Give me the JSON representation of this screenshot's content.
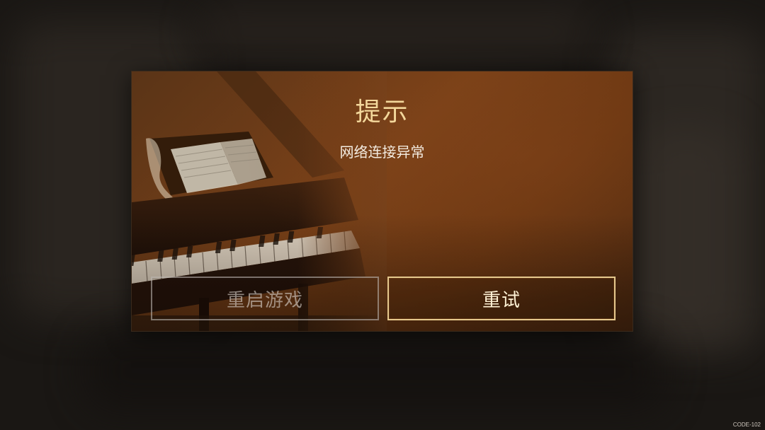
{
  "dialog": {
    "title": "提示",
    "message": "网络连接异常",
    "buttons": {
      "restart_label": "重启游戏",
      "retry_label": "重试"
    }
  },
  "footer": {
    "code": "CODE-102"
  },
  "colors": {
    "title": "#f3d79b",
    "accent_border": "#e6c98e",
    "dialog_bg": "#7a4118",
    "page_bg": "#1a1714"
  },
  "icons": {
    "background_art": "piano-image"
  }
}
